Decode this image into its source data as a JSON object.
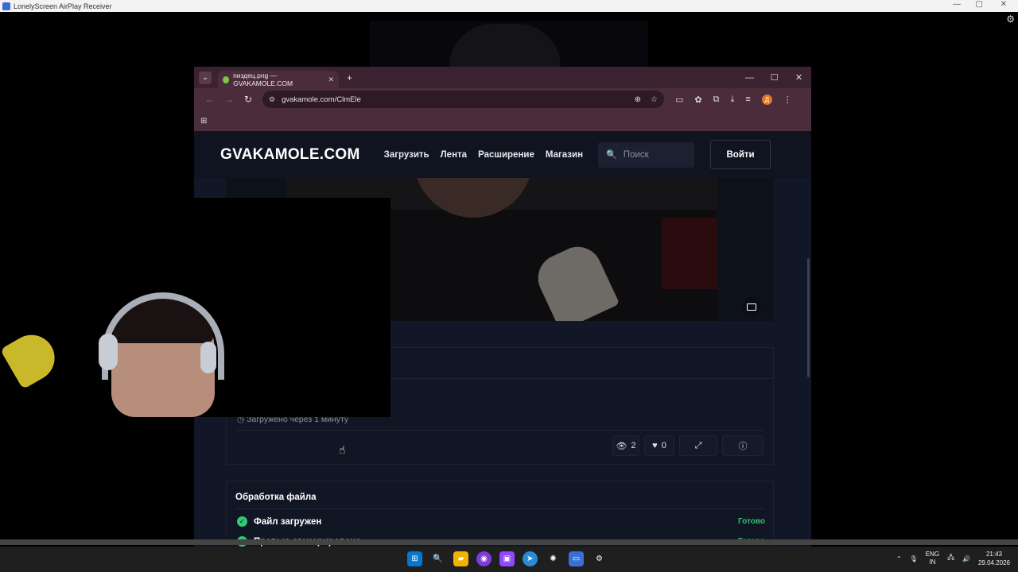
{
  "outer_window": {
    "title": "LonelyScreen AirPlay Receiver"
  },
  "browser": {
    "tab_title": "пиздец.png — GVAKAMOLE.COM",
    "url": "gvakamole.com/ClmEle"
  },
  "site": {
    "logo": "GVAKAMOLE.COM",
    "nav": [
      "Загрузить",
      "Лента",
      "Расширение",
      "Магазин"
    ],
    "search_placeholder": "Поиск",
    "login": "Войти",
    "uploaded_text": "Загружено через 1 минуту",
    "views": "2",
    "likes": "0",
    "processing": {
      "title": "Обработка файла",
      "steps": [
        {
          "label": "Файл загружен",
          "status": "Готово"
        },
        {
          "label": "Превью сгенерировано",
          "status": "Готово"
        }
      ]
    }
  },
  "taskbar": {
    "lang": [
      "ENG",
      "IN"
    ],
    "time": "21:43",
    "date": "29.04.2026"
  },
  "colors": {
    "accent_green": "#32c36c",
    "browser_frame": "#4b2c3b",
    "page_bg": "#121727"
  }
}
